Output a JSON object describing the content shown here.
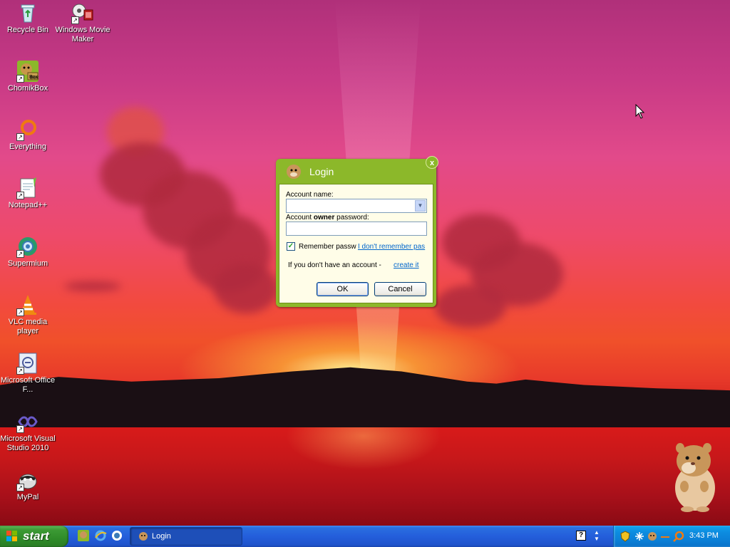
{
  "desktop": {
    "icons": [
      {
        "label": "Recycle Bin",
        "icon": "recycle-bin-icon"
      },
      {
        "label": "Windows Movie Maker",
        "icon": "movie-maker-icon"
      },
      {
        "label": "ChomikBox",
        "icon": "chomikbox-icon"
      },
      {
        "label": "Everything",
        "icon": "everything-icon"
      },
      {
        "label": "Notepad++",
        "icon": "notepadpp-icon"
      },
      {
        "label": "Supermium",
        "icon": "supermium-icon"
      },
      {
        "label": "VLC media player",
        "icon": "vlc-icon"
      },
      {
        "label": "Microsoft Office F...",
        "icon": "office-icon"
      },
      {
        "label": "Microsoft Visual Studio 2010",
        "icon": "visual-studio-icon"
      },
      {
        "label": "MyPal",
        "icon": "mypal-icon"
      }
    ]
  },
  "dialog": {
    "title": "Login",
    "close_label": "x",
    "account_name_label": "Account name:",
    "account_name_value": "",
    "password_label_prefix": "Account ",
    "password_label_bold": "owner",
    "password_label_suffix": " password:",
    "password_value": "",
    "remember_label": "Remember passw",
    "remember_checked": true,
    "forgot_link": "I don't remember pas",
    "no_account_text": "If you don't have an account - ",
    "create_link": "create it",
    "ok_label": "OK",
    "cancel_label": "Cancel",
    "accent_color": "#8cb82a"
  },
  "taskbar": {
    "start_label": "start",
    "quick_launch": [
      "chomikbox-icon",
      "internet-explorer-icon",
      "supermium-icon"
    ],
    "tasks": [
      {
        "label": "Login",
        "icon": "chomikbox-icon",
        "active": true
      }
    ],
    "tray_icons": [
      "help-icon",
      "language-icon",
      "security-shield-icon",
      "network-icon",
      "chomikbox-icon",
      "everything-icon"
    ],
    "clock": "3:43 PM"
  }
}
